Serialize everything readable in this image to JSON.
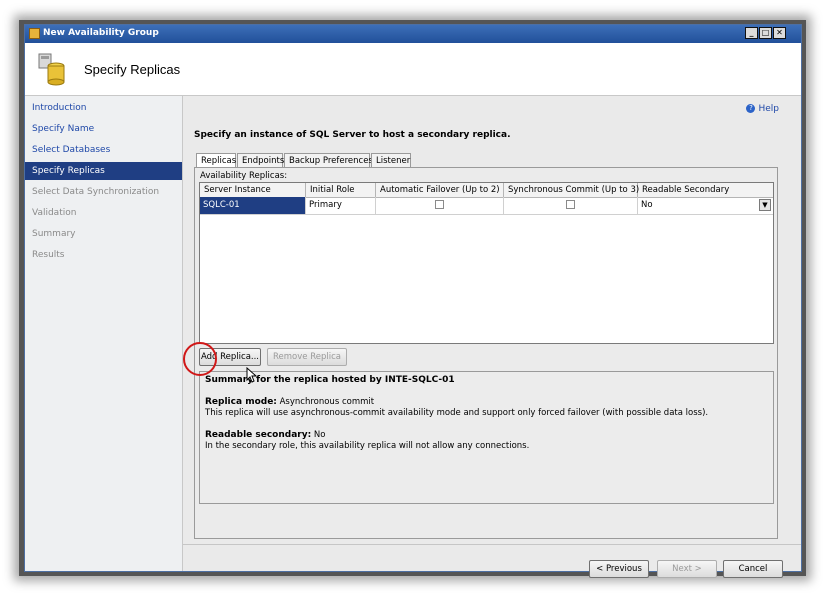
{
  "window": {
    "title": "New Availability Group"
  },
  "header": {
    "title": "Specify Replicas"
  },
  "sidebar": {
    "items": [
      {
        "label": "Introduction",
        "state": "link"
      },
      {
        "label": "Specify Name",
        "state": "link"
      },
      {
        "label": "Select Databases",
        "state": "link"
      },
      {
        "label": "Specify Replicas",
        "state": "active"
      },
      {
        "label": "Select Data Synchronization",
        "state": "disabled"
      },
      {
        "label": "Validation",
        "state": "disabled"
      },
      {
        "label": "Summary",
        "state": "disabled"
      },
      {
        "label": "Results",
        "state": "disabled"
      }
    ]
  },
  "main": {
    "help_label": "Help",
    "instruction": "Specify an instance of SQL Server to host a secondary replica.",
    "tabs": [
      {
        "label": "Replicas",
        "active": true
      },
      {
        "label": "Endpoints"
      },
      {
        "label": "Backup Preferences"
      },
      {
        "label": "Listener"
      }
    ],
    "replicas_label": "Availability Replicas:",
    "grid": {
      "columns": [
        "Server Instance",
        "Initial Role",
        "Automatic Failover (Up to 2)",
        "Synchronous Commit (Up to 3)",
        "Readable Secondary"
      ],
      "rows": [
        {
          "server": "SQLC-01",
          "role": "Primary",
          "auto_failover": false,
          "sync_commit": false,
          "readable": "No"
        }
      ]
    },
    "buttons": {
      "add_replica": "Add Replica...",
      "remove_replica": "Remove Replica"
    },
    "summary": {
      "heading": "Summary for the replica hosted by INTE-SQLC-01",
      "mode_label": "Replica mode:",
      "mode_value": "Asynchronous commit",
      "mode_desc": "This replica will use asynchronous-commit availability mode and support only forced failover (with possible data loss).",
      "readable_label": "Readable secondary:",
      "readable_value": "No",
      "readable_desc": "In the secondary role, this availability replica will not allow any connections."
    },
    "footer": {
      "previous": "< Previous",
      "next": "Next >",
      "cancel": "Cancel"
    }
  },
  "colors": {
    "accent": "#1f3e83",
    "link": "#1f48a8",
    "titlebar": "#21509a",
    "highlight": "#d01818"
  }
}
